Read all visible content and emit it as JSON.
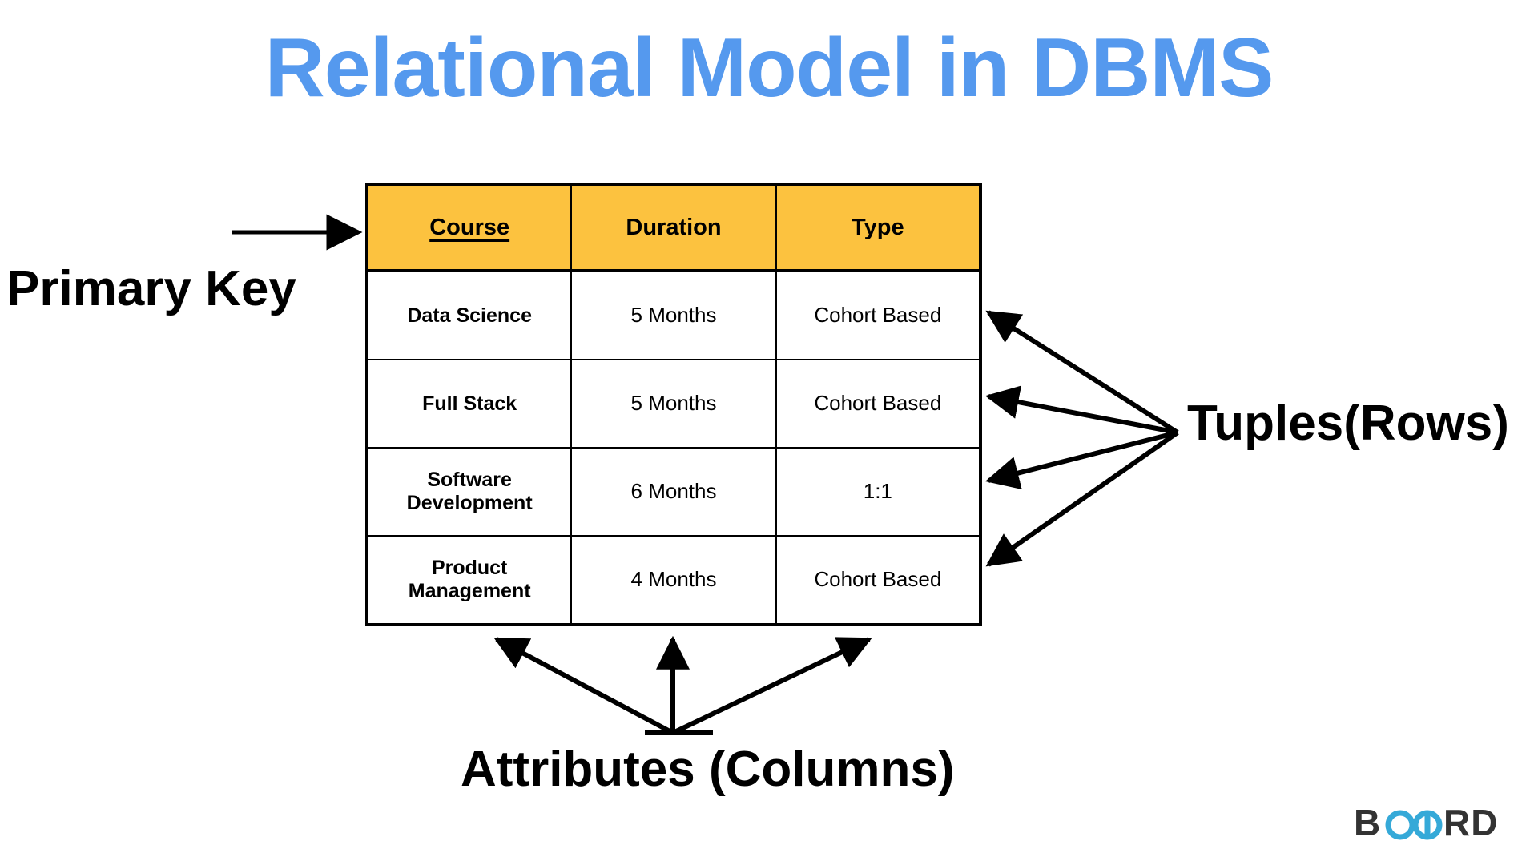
{
  "page": {
    "title": "Relational Model in DBMS",
    "title_color": "#5599EE",
    "background_color": "#FFFFFF"
  },
  "table": {
    "header_bg_color": "#FCC23F",
    "border_color": "#000000",
    "primary_key_column": "Course",
    "columns": [
      "Course",
      "Duration",
      "Type"
    ],
    "rows": [
      {
        "course": "Data Science",
        "duration": "5 Months",
        "type": "Cohort Based"
      },
      {
        "course": "Full Stack",
        "duration": "5 Months",
        "type": "Cohort Based"
      },
      {
        "course": "Software Development",
        "duration": "6 Months",
        "type": "1:1"
      },
      {
        "course": "Product Management",
        "duration": "4 Months",
        "type": "Cohort Based"
      }
    ]
  },
  "annotations": {
    "primary_key": "Primary Key",
    "tuples": "Tuples(Rows)",
    "attributes": "Attributes (Columns)"
  },
  "logo": {
    "text_before": "B",
    "text_mark": "OA",
    "text_after": "RD",
    "full_text": "BOARD",
    "mark_color": "#35A9D8",
    "text_color": "#333333"
  }
}
